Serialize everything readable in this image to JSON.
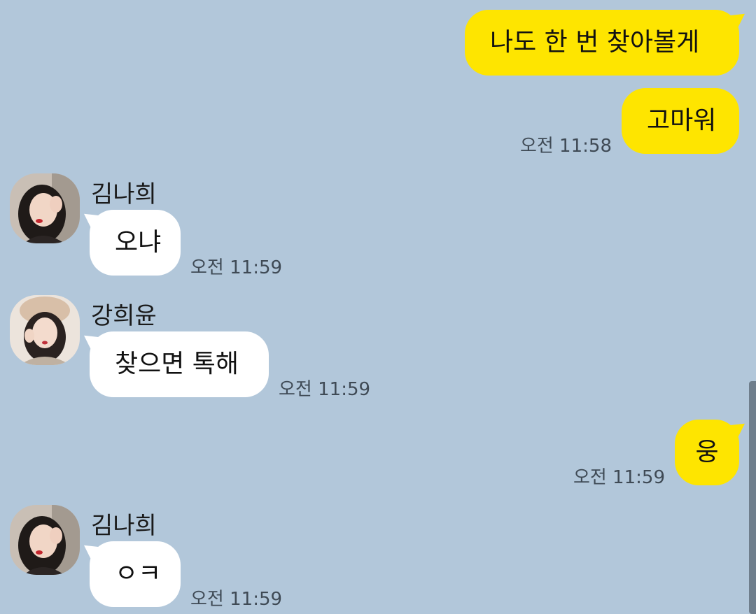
{
  "messages": [
    {
      "sender": "me",
      "text": "나도 한 번 찾아볼게"
    },
    {
      "sender": "me",
      "text": "고마워",
      "time": "오전 11:58"
    },
    {
      "sender": "김나희",
      "text": "오냐",
      "time": "오전 11:59"
    },
    {
      "sender": "강희윤",
      "text": "찾으면 톡해",
      "time": "오전 11:59"
    },
    {
      "sender": "me",
      "text": "웅",
      "time": "오전 11:59"
    },
    {
      "sender": "김나희",
      "text": "ㅇㅋ",
      "time": "오전 11:59"
    }
  ],
  "colors": {
    "background": "#b2c7da",
    "my_bubble": "#fee500",
    "other_bubble": "#ffffff",
    "time_text": "#3f4a55"
  }
}
